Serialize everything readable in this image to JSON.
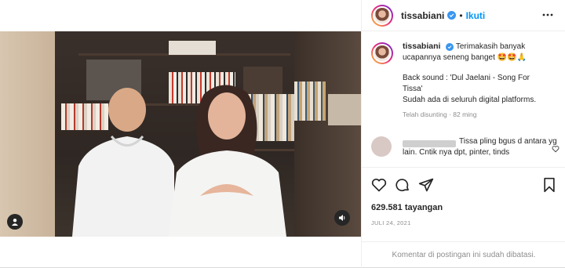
{
  "post": {
    "username": "tissabiani",
    "follow_label": "Ikuti",
    "separator": "•",
    "caption": {
      "username": "tissabiani",
      "line1": "Terimakasih banyak",
      "line2": "ucapannya seneng banget 🤩🤩🙏",
      "line3": "Back sound : 'Dul Jaelani - Song For",
      "line4": "Tissa'",
      "line5": "Sudah ada di seluruh digital platforms.",
      "meta": "Telah disunting · 82 ming"
    },
    "comment": {
      "text": "Tissa pling bgus d antara yg lain. Cntik nya dpt, pinter, tinds"
    },
    "views": "629.581 tayangan",
    "date": "JULI 24, 2021",
    "comments_closed": "Komentar di postingan ini sudah dibatasi."
  },
  "icons": {
    "more": "more-dots-icon",
    "like": "heart-icon",
    "comment": "comment-bubble-icon",
    "share": "paper-plane-icon",
    "save": "bookmark-icon",
    "user_tag": "user-icon",
    "sound": "speaker-icon"
  },
  "colors": {
    "accent": "#0095f6",
    "verified": "#3897f0",
    "muted": "#8e8e8e",
    "text": "#262626"
  }
}
